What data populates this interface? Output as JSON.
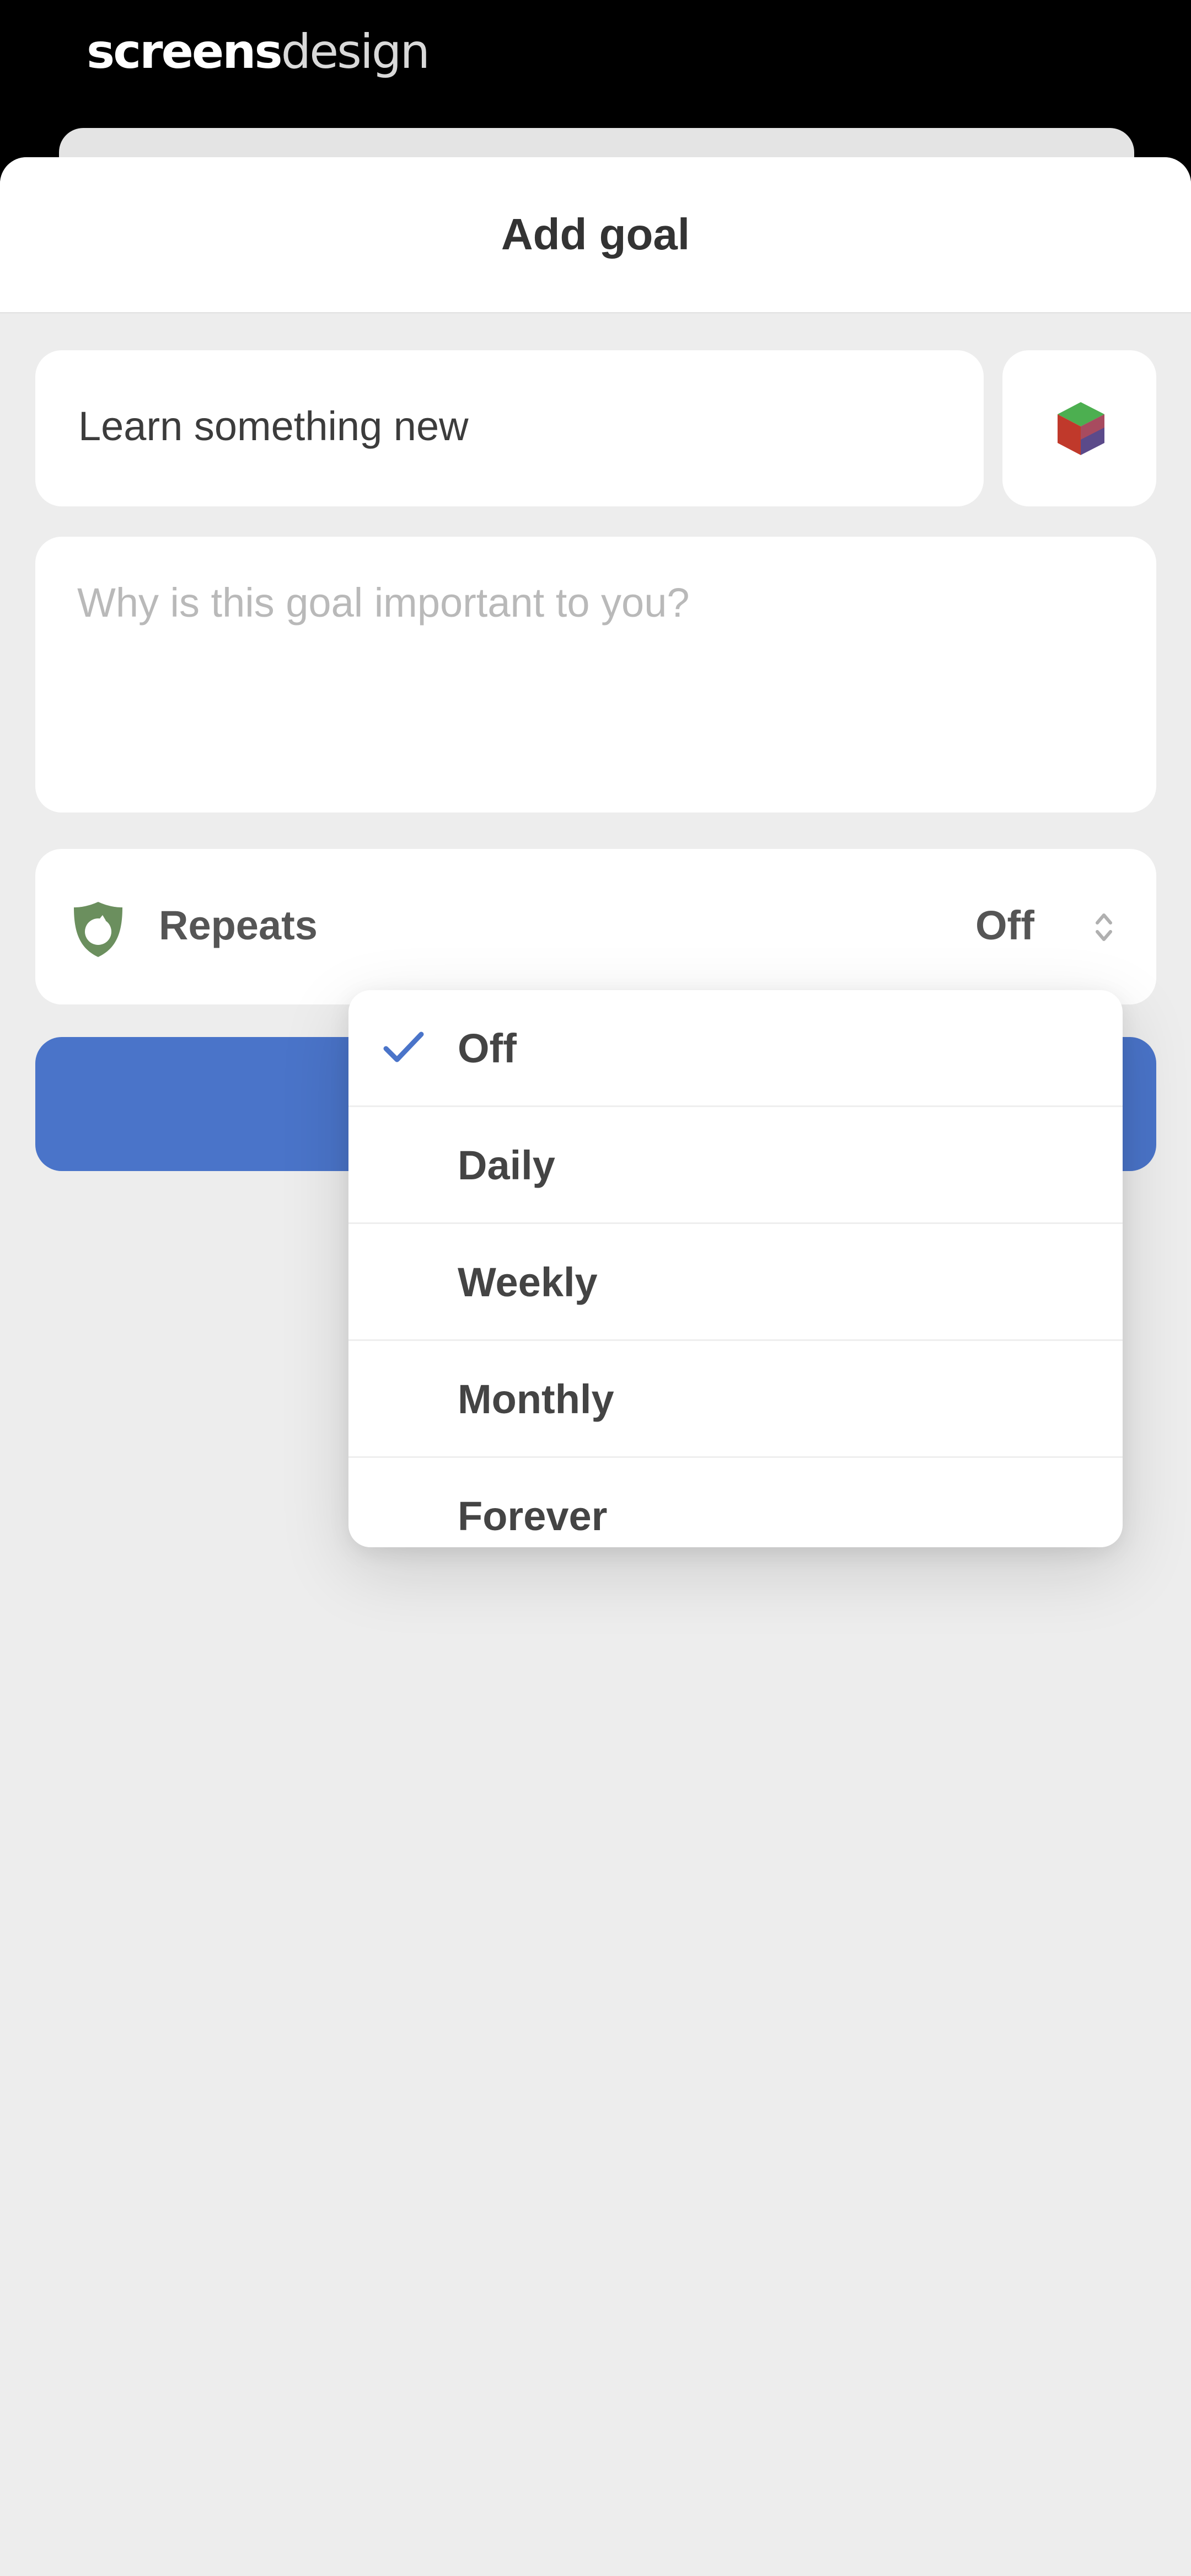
{
  "watermark": {
    "strong": "screens",
    "light": "design"
  },
  "sheet": {
    "title": "Add goal"
  },
  "goal": {
    "name": "Learn something new",
    "icon": "cube-emoji-icon"
  },
  "why": {
    "placeholder": "Why is this goal important to you?",
    "value": ""
  },
  "repeats": {
    "label": "Repeats",
    "value": "Off",
    "icon": "repeat-shield-icon"
  },
  "dropdown": {
    "selected": "Off",
    "options": [
      {
        "label": "Off"
      },
      {
        "label": "Daily"
      },
      {
        "label": "Weekly"
      },
      {
        "label": "Monthly"
      },
      {
        "label": "Forever"
      }
    ]
  },
  "colors": {
    "accent": "#4a74c9",
    "check": "#4a74c9",
    "background": "#ededed",
    "card": "#ffffff",
    "repeat_icon": "#6b8f5e"
  }
}
